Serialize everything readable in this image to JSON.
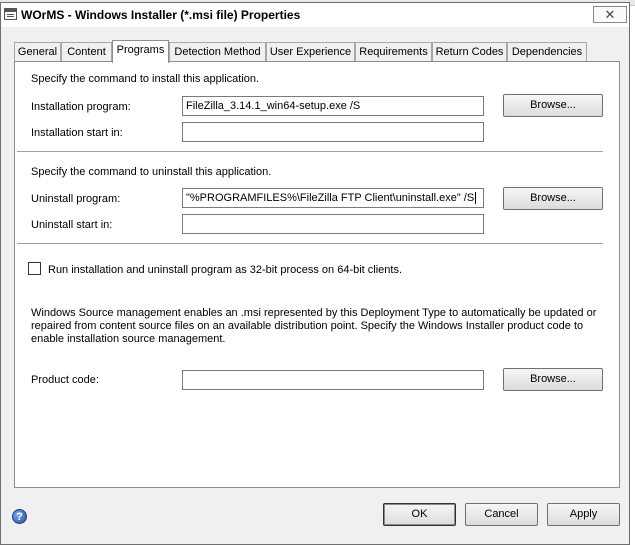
{
  "window": {
    "title": "WOrMS - Windows Installer (*.msi file) Properties",
    "close_glyph": "✕"
  },
  "tabs": [
    {
      "label": "General",
      "active": false
    },
    {
      "label": "Content",
      "active": false
    },
    {
      "label": "Programs",
      "active": true
    },
    {
      "label": "Detection Method",
      "active": false
    },
    {
      "label": "User Experience",
      "active": false
    },
    {
      "label": "Requirements",
      "active": false
    },
    {
      "label": "Return Codes",
      "active": false
    },
    {
      "label": "Dependencies",
      "active": false
    }
  ],
  "install": {
    "heading": "Specify the command to install this application.",
    "program_label": "Installation program:",
    "program_value": "FileZilla_3.14.1_win64-setup.exe /S",
    "start_label": "Installation start in:",
    "start_value": "",
    "browse_label": "Browse..."
  },
  "uninstall": {
    "heading": "Specify the command to uninstall this application.",
    "program_label": "Uninstall program:",
    "program_value": "\"%PROGRAMFILES%\\FileZilla FTP Client\\uninstall.exe\" /S",
    "start_label": "Uninstall start in:",
    "start_value": "",
    "browse_label": "Browse..."
  },
  "run32": {
    "label": "Run installation and uninstall program as 32-bit process on 64-bit clients.",
    "checked": false
  },
  "source_mgmt": {
    "description": "Windows Source management enables an .msi represented by this Deployment Type to automatically be updated or repaired from content source files on an available distribution point. Specify the Windows Installer product code to enable installation source management.",
    "product_code_label": "Product code:",
    "product_code_value": "",
    "browse_label": "Browse..."
  },
  "footer": {
    "help_glyph": "?",
    "ok_label": "OK",
    "cancel_label": "Cancel",
    "apply_label": "Apply"
  }
}
